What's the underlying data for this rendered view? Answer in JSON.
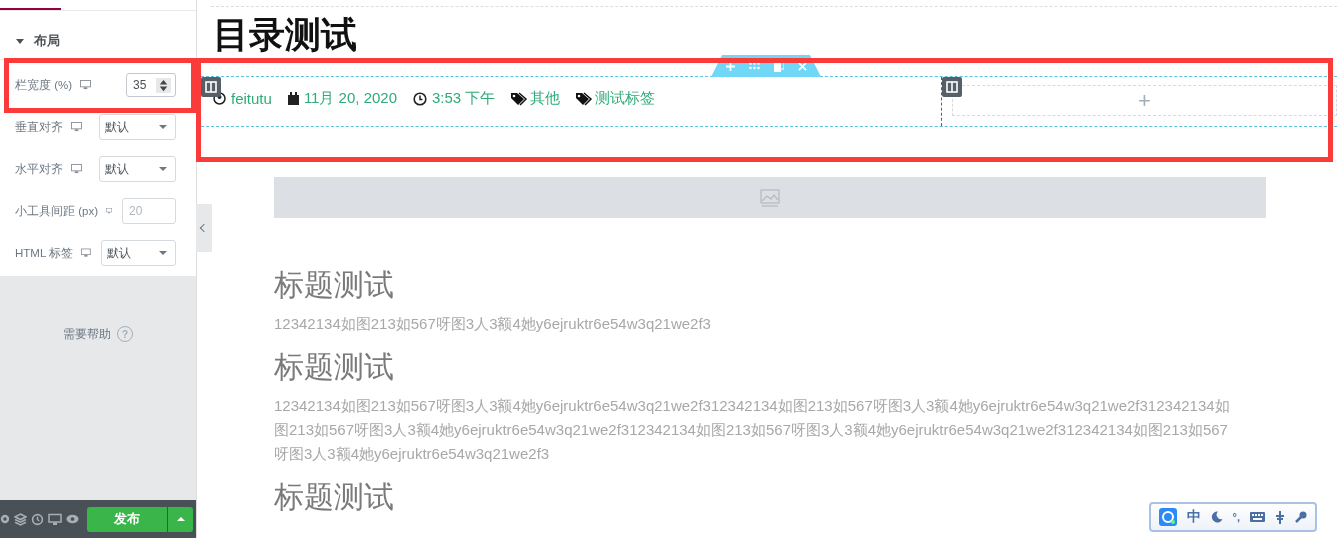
{
  "sidebar": {
    "section": {
      "title": "布局",
      "expanded": true
    },
    "controls": [
      {
        "kind": "number",
        "label": "栏宽度 (%)",
        "value": "35"
      },
      {
        "kind": "select",
        "label": "垂直对齐",
        "value": "默认"
      },
      {
        "kind": "select",
        "label": "水平对齐",
        "value": "默认"
      },
      {
        "kind": "number-placeholder",
        "label": "小工具间距 (px)",
        "placeholder": "20"
      },
      {
        "kind": "select",
        "label": "HTML 标签",
        "value": "默认"
      }
    ],
    "help": {
      "label": "需要帮助",
      "icon": "?"
    },
    "footer": {
      "publish": "发布"
    }
  },
  "canvas": {
    "title": "目录测试",
    "meta": [
      {
        "kind": "author",
        "text": "feitutu"
      },
      {
        "kind": "date",
        "text": "11月 20, 2020"
      },
      {
        "kind": "time",
        "text": "3:53 下午"
      },
      {
        "kind": "tag",
        "text": "其他"
      },
      {
        "kind": "tag",
        "text": "测试标签"
      }
    ],
    "empty_column": {
      "icon": "+"
    },
    "content": [
      {
        "kind": "heading",
        "text": "标题测试"
      },
      {
        "kind": "paragraph",
        "text": "12342134如图213如567呀图3人3额4她y6ejruktr6e54w3q21we2f3"
      },
      {
        "kind": "heading",
        "text": "标题测试"
      },
      {
        "kind": "paragraph",
        "text": "12342134如图213如567呀图3人3额4她y6ejruktr6e54w3q21we2f312342134如图213如567呀图3人3额4她y6ejruktr6e54w3q21we2f312342134如图213如567呀图3人3额4她y6ejruktr6e54w3q21we2f312342134如图213如567呀图3人3额4她y6ejruktr6e54w3q21we2f312342134如图213如567呀图3人3额4她y6ejruktr6e54w3q21we2f3"
      },
      {
        "kind": "heading",
        "text": "标题测试"
      }
    ]
  },
  "ime_toolbar": {
    "mode": "中",
    "punctuation": "°,"
  }
}
